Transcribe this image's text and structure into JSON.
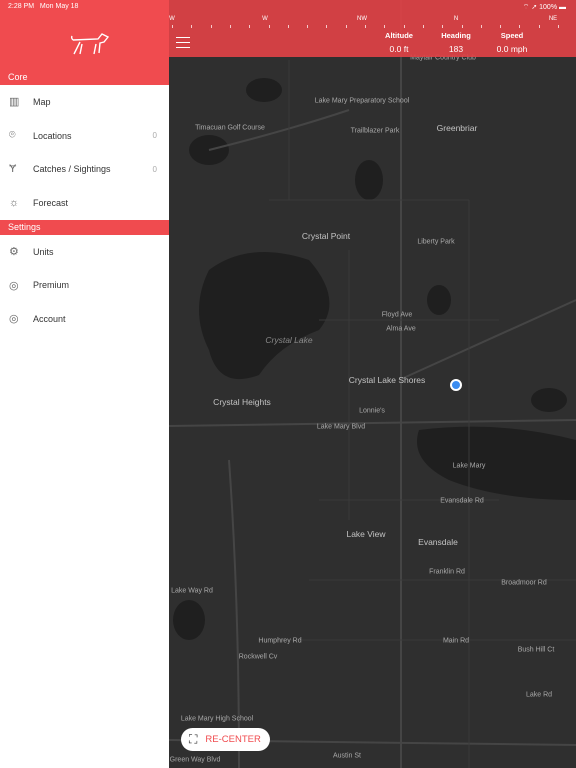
{
  "status": {
    "time": "2:28 PM",
    "date": "Mon May 18",
    "battery": "100%"
  },
  "compass": {
    "directions": [
      "W",
      "W",
      "NW",
      "N",
      "NE"
    ]
  },
  "stats": [
    {
      "label": "Altitude",
      "value": "0.0 ft"
    },
    {
      "label": "Heading",
      "value": "183"
    },
    {
      "label": "Speed",
      "value": "0.0 mph"
    }
  ],
  "drawer": {
    "sections": {
      "core": "Core",
      "settings": "Settings"
    },
    "core_items": [
      {
        "label": "Map",
        "icon": "map-icon"
      },
      {
        "label": "Locations",
        "count": "0",
        "icon": "location-pin-icon"
      },
      {
        "label": "Catches / Sightings",
        "count": "0",
        "icon": "antlers-icon"
      },
      {
        "label": "Forecast",
        "icon": "sun-icon"
      }
    ],
    "settings_items": [
      {
        "label": "Units",
        "icon": "gear-icon"
      },
      {
        "label": "Premium",
        "icon": "target-icon"
      },
      {
        "label": "Account",
        "icon": "target-icon"
      }
    ]
  },
  "map": {
    "labels": [
      "Maytair Country Club",
      "Lake Mary Preparatory School",
      "Greenbriar",
      "Trailblazer Park",
      "Timacuan Golf Course",
      "Crystal Point",
      "Liberty Park",
      "Crystal Lake",
      "Crystal Lake Shores",
      "Crystal Heights",
      "Lake Mary Blvd",
      "Lake Mary",
      "Lake View",
      "Evansdale",
      "Franklin Rd",
      "Broadmoor Rd",
      "Main Rd",
      "Humphrey Rd",
      "Rockwell Cv",
      "Lake Mary High School",
      "Austin St",
      "Lake Way Rd",
      "Evansdale Rd",
      "Floyd Ave",
      "Alma Ave",
      "Lonnie's",
      "Lake Rd",
      "Bush Hill Ct",
      "Green Way Blvd"
    ]
  },
  "recenter": {
    "label": "RE-CENTER"
  },
  "colors": {
    "accent": "#f04b4f",
    "map_bg": "#2f2f2f",
    "location_dot": "#3b8cf0"
  }
}
